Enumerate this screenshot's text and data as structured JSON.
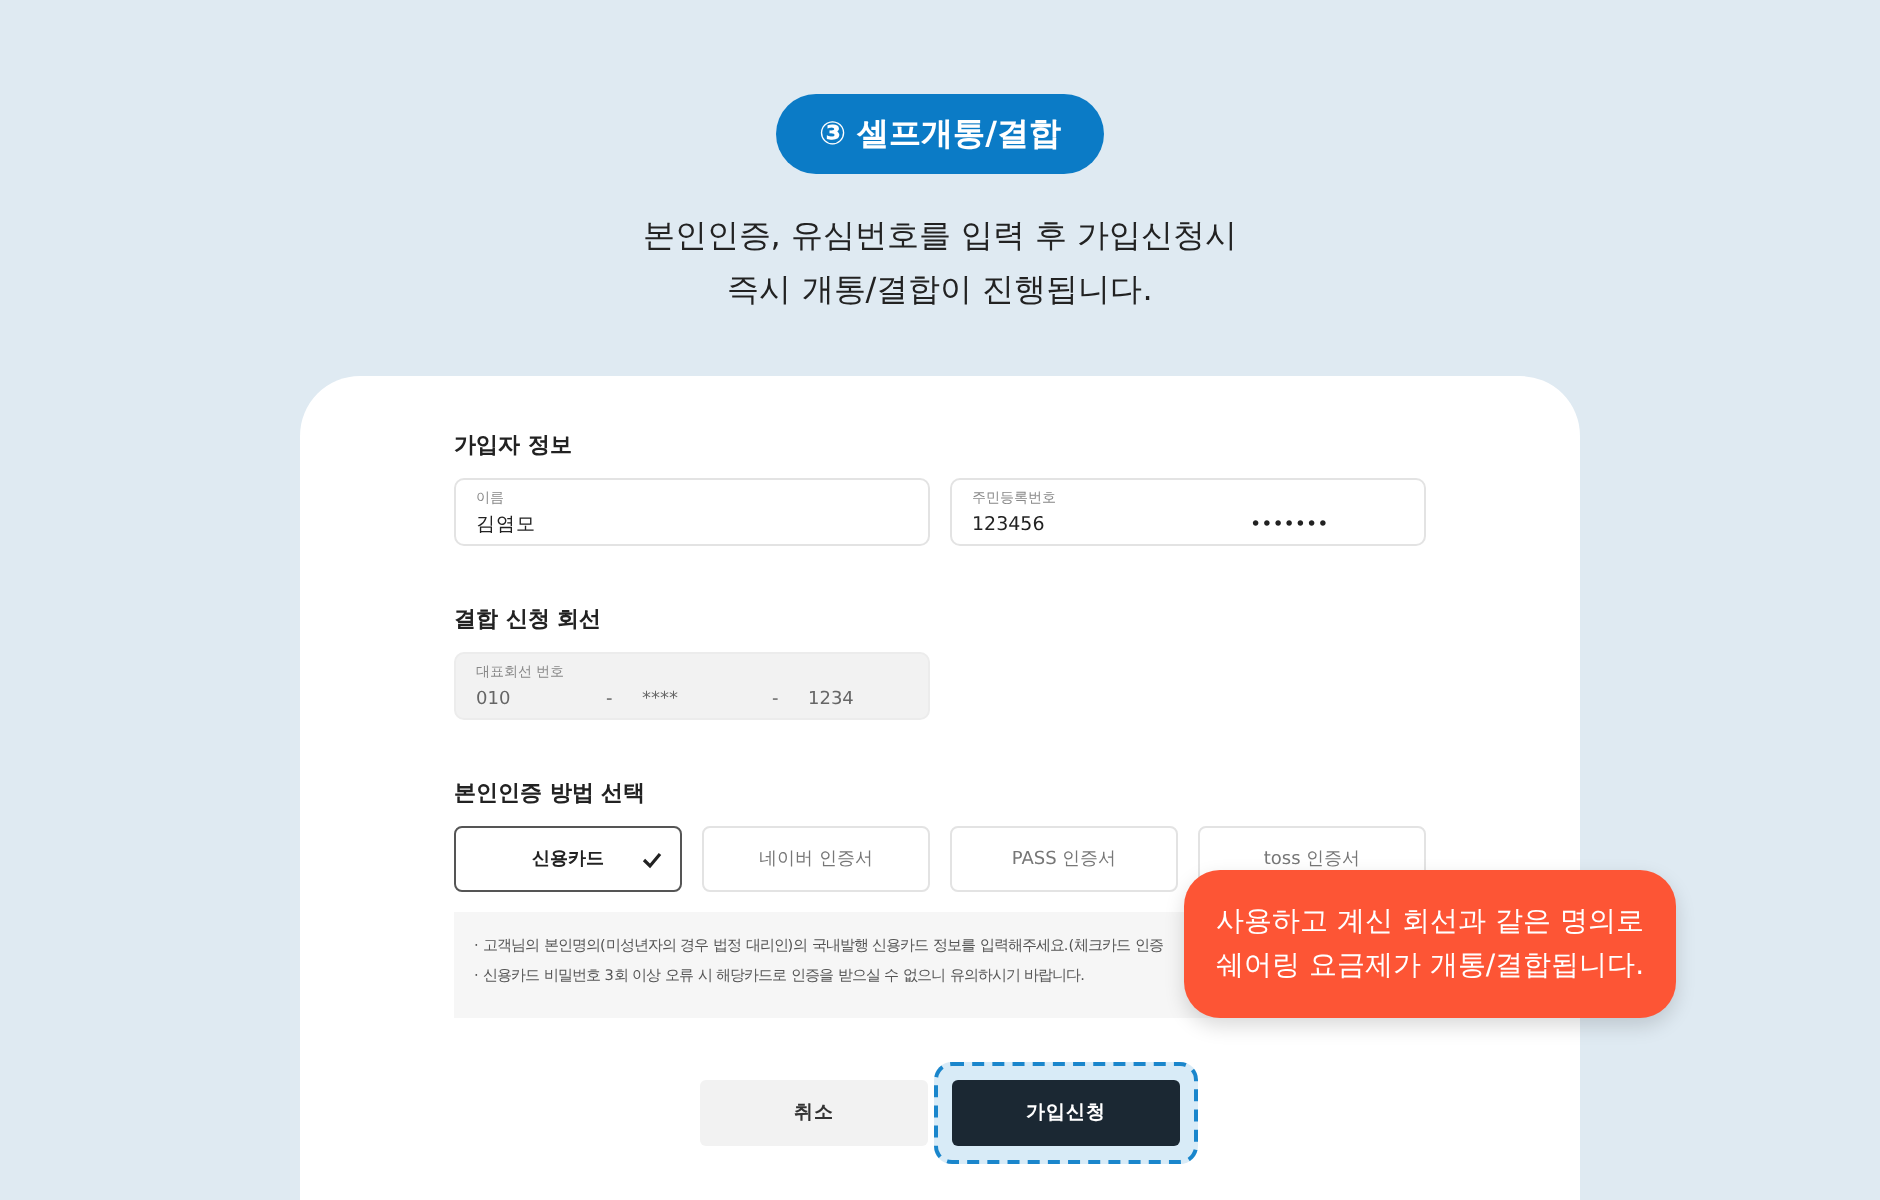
{
  "badge": {
    "label": "③ 셀프개통/결합"
  },
  "intro": [
    "본인인증, 유심번호를 입력 후 가입신청시",
    "즉시 개통/결합이 진행됩니다."
  ],
  "form": {
    "sections": [
      {
        "title": "가입자 정보",
        "fields": [
          {
            "kind": "plain",
            "label": "이름",
            "parts": [
              "김염모"
            ],
            "disabled": false
          },
          {
            "kind": "split",
            "label": "주민등록번호",
            "parts": [
              "123456",
              "•••••••"
            ],
            "disabled": false
          }
        ]
      },
      {
        "title": "결합 신청 회선",
        "fields": [
          {
            "kind": "phone",
            "label": "대표회선 번호",
            "parts": [
              "010",
              "-",
              "****",
              "-",
              "1234"
            ],
            "disabled": true
          }
        ]
      },
      {
        "title": "본인인증 방법 선택",
        "options": [
          {
            "label": "신용카드",
            "selected": true
          },
          {
            "label": "네이버 인증서",
            "selected": false
          },
          {
            "label": "PASS 인증서",
            "selected": false
          },
          {
            "label": "toss 인증서",
            "selected": false
          }
        ],
        "notice": [
          "· 고객님의 본인명의(미성년자의 경우 법정 대리인)의 국내발행 신용카드 정보를 입력해주세요.(체크카드 인증",
          "· 신용카드 비밀번호 3회 이상 오류 시 해당카드로 인증을 받으실 수 없으니 유의하시기 바랍니다."
        ]
      }
    ],
    "buttons": [
      {
        "kind": "secondary",
        "label": "취소",
        "highlighted": false
      },
      {
        "kind": "primary",
        "label": "가입신청",
        "highlighted": true
      }
    ]
  },
  "callout": {
    "lines": [
      "사용하고 계신 회선과 같은 명의로",
      "쉐어링 요금제가 개통/결합됩니다."
    ]
  }
}
